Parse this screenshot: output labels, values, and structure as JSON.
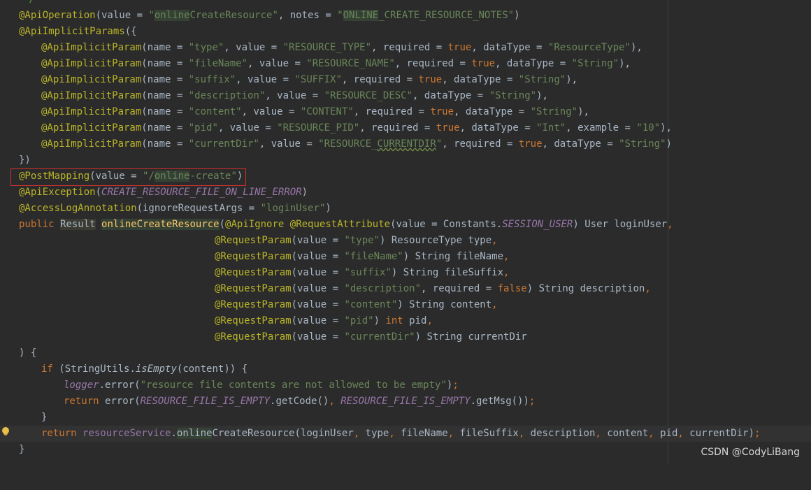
{
  "lines": {
    "l0": {
      "t0": "*/"
    },
    "l1": {
      "t0": "@ApiOperation",
      "t1": "(value = ",
      "t2": "\"",
      "t3": "online",
      "t4": "CreateResource\"",
      "t5": ", notes = ",
      "t6": "\"",
      "t7": "ONLINE",
      "t8": "_CREATE_RESOURCE_NOTES\"",
      "t9": ")"
    },
    "l2": {
      "t0": "@ApiImplicitParams",
      "t1": "({"
    },
    "l3": {
      "t0": "@ApiImplicitParam",
      "t1": "(name = ",
      "t2": "\"type\"",
      "t3": ", value = ",
      "t4": "\"RESOURCE_TYPE\"",
      "t5": ", required = ",
      "t6": "true",
      "t7": ", dataType = ",
      "t8": "\"ResourceType\"",
      "t9": "),"
    },
    "l4": {
      "t0": "@ApiImplicitParam",
      "t1": "(name = ",
      "t2": "\"fileName\"",
      "t3": ", value = ",
      "t4": "\"RESOURCE_NAME\"",
      "t5": ", required = ",
      "t6": "true",
      "t7": ", dataType = ",
      "t8": "\"String\"",
      "t9": "),"
    },
    "l5": {
      "t0": "@ApiImplicitParam",
      "t1": "(name = ",
      "t2": "\"suffix\"",
      "t3": ", value = ",
      "t4": "\"SUFFIX\"",
      "t5": ", required = ",
      "t6": "true",
      "t7": ", dataType = ",
      "t8": "\"String\"",
      "t9": "),"
    },
    "l6": {
      "t0": "@ApiImplicitParam",
      "t1": "(name = ",
      "t2": "\"description\"",
      "t3": ", value = ",
      "t4": "\"RESOURCE_DESC\"",
      "t5": ", dataType = ",
      "t6": "\"String\"",
      "t7": "),"
    },
    "l7": {
      "t0": "@ApiImplicitParam",
      "t1": "(name = ",
      "t2": "\"content\"",
      "t3": ", value = ",
      "t4": "\"CONTENT\"",
      "t5": ", required = ",
      "t6": "true",
      "t7": ", dataType = ",
      "t8": "\"String\"",
      "t9": "),"
    },
    "l8": {
      "t0": "@ApiImplicitParam",
      "t1": "(name = ",
      "t2": "\"pid\"",
      "t3": ", value = ",
      "t4": "\"RESOURCE_PID\"",
      "t5": ", required = ",
      "t6": "true",
      "t7": ", dataType = ",
      "t8": "\"Int\"",
      "t9": ", example = ",
      "t10": "\"10\"",
      "t11": "),"
    },
    "l9": {
      "t0": "@ApiImplicitParam",
      "t1": "(name = ",
      "t2": "\"currentDir\"",
      "t3": ", value = ",
      "t4": "\"RESOURCE_",
      "t5": "CURRENTDIR",
      "t6": "\"",
      "t7": ", required = ",
      "t8": "true",
      "t9": ", dataType = ",
      "t10": "\"String\"",
      "t11": ")"
    },
    "l10": {
      "t0": "})"
    },
    "l11": {
      "t0": "@PostMapping",
      "t1": "(value = ",
      "t2": "\"/",
      "t3": "online",
      "t4": "-create\"",
      "t5": ")"
    },
    "l12": {
      "t0": "@ApiException",
      "t1": "(",
      "t2": "CREATE_RESOURCE_FILE_ON_LINE_ERROR",
      "t3": ")"
    },
    "l13": {
      "t0": "@AccessLogAnnotation",
      "t1": "(ignoreRequestArgs = ",
      "t2": "\"loginUser\"",
      "t3": ")"
    },
    "l14": {
      "t0": "public ",
      "t1": "Result",
      "t2": " ",
      "t3": "onlineCreateResource",
      "t4": "(",
      "t5": "@ApiIgnore ",
      "t6": "@RequestAttribute",
      "t7": "(value = Constants.",
      "t8": "SESSION_USER",
      "t9": ") User loginUser",
      "t10": ","
    },
    "l15": {
      "t0": "@RequestParam",
      "t1": "(value = ",
      "t2": "\"type\"",
      "t3": ") ResourceType type",
      "t4": ","
    },
    "l16": {
      "t0": "@RequestParam",
      "t1": "(value = ",
      "t2": "\"fileName\"",
      "t3": ") String fileName",
      "t4": ","
    },
    "l17": {
      "t0": "@RequestParam",
      "t1": "(value = ",
      "t2": "\"suffix\"",
      "t3": ") String fileSuffix",
      "t4": ","
    },
    "l18": {
      "t0": "@RequestParam",
      "t1": "(value = ",
      "t2": "\"description\"",
      "t3": ", required = ",
      "t4": "false",
      "t5": ") String description",
      "t6": ","
    },
    "l19": {
      "t0": "@RequestParam",
      "t1": "(value = ",
      "t2": "\"content\"",
      "t3": ") String content",
      "t4": ","
    },
    "l20": {
      "t0": "@RequestParam",
      "t1": "(value = ",
      "t2": "\"pid\"",
      "t3": ") ",
      "t4": "int ",
      "t5": "pid",
      "t6": ","
    },
    "l21": {
      "t0": "@RequestParam",
      "t1": "(value = ",
      "t2": "\"currentDir\"",
      "t3": ") String currentDir"
    },
    "l22": {
      "t0": ") {"
    },
    "l23": {
      "t0": "if ",
      "t1": "(StringUtils.",
      "t2": "isEmpty",
      "t3": "(content)) {"
    },
    "l24": {
      "t0": "logger",
      "t1": ".error(",
      "t2": "\"resource file contents are not allowed to be empty\"",
      "t3": ")",
      "t4": ";"
    },
    "l25": {
      "t0": "return ",
      "t1": "error(",
      "t2": "RESOURCE_FILE_IS_EMPTY",
      "t3": ".getCode()",
      "t4": ", ",
      "t5": "RESOURCE_FILE_IS_EMPTY",
      "t6": ".getMsg())",
      "t7": ";"
    },
    "l26": {
      "t0": "}"
    },
    "l27": {
      "t0": "return ",
      "t1": "resourceService",
      "t2": ".",
      "t3": "online",
      "t4": "CreateResource",
      "t5": "(loginUser",
      "t6": ", ",
      "t7": "type",
      "t8": ", ",
      "t9": "fileName",
      "t10": ", ",
      "t11": "fileSuffix",
      "t12": ", ",
      "t13": "description",
      "t14": ", ",
      "t15": "content",
      "t16": ", ",
      "t17": "pid",
      "t18": ", ",
      "t19": "currentDir)",
      "t20": ";"
    },
    "l28": {
      "t0": "}"
    }
  },
  "watermark": "CSDN @CodyLiBang",
  "colors": {
    "background": "#2b2b2b",
    "annotation": "#bbb529",
    "string": "#6a8759",
    "keyword": "#cc7832",
    "constant": "#9876aa",
    "method": "#ffc66d",
    "highlight_box": "#d0312d"
  }
}
